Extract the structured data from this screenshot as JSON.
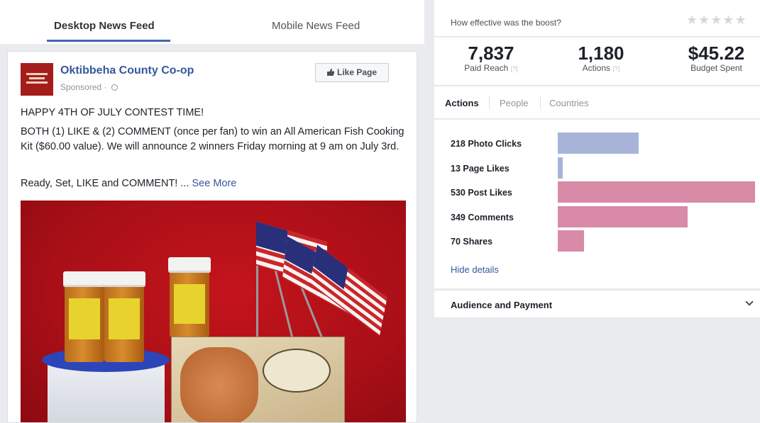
{
  "feed_tabs": {
    "desktop": "Desktop News Feed",
    "mobile": "Mobile News Feed"
  },
  "post": {
    "page_name": "Oktibbeha County Co-op",
    "sponsored": "Sponsored ·",
    "like_page": "Like Page",
    "headline": "HAPPY 4TH OF JULY CONTEST TIME!",
    "body": "BOTH (1) LIKE & (2) COMMENT (once per fan) to win an All American Fish Cooking Kit ($60.00 value). We will announce 2 winners Friday morning at 9 am on July 3rd.",
    "cta": "Ready, Set, LIKE and COMMENT! ...",
    "see_more": "See More"
  },
  "rating": {
    "question": "How effective was the boost?",
    "stars": "★★★★★"
  },
  "metrics": {
    "paid_reach": {
      "value": "7,837",
      "label": "Paid Reach",
      "hint": "[?]"
    },
    "actions": {
      "value": "1,180",
      "label": "Actions",
      "hint": "[?]"
    },
    "budget": {
      "value": "$45.22",
      "label": "Budget Spent"
    }
  },
  "subtabs": [
    "Actions",
    "People",
    "Countries"
  ],
  "action_rows": [
    {
      "label": "218 Photo Clicks",
      "value": 218,
      "color": "#a7b4d8"
    },
    {
      "label": "13 Page Likes",
      "value": 13,
      "color": "#a7b4d8"
    },
    {
      "label": "530 Post Likes",
      "value": 530,
      "color": "#d88aa6"
    },
    {
      "label": "349 Comments",
      "value": 349,
      "color": "#d88aa6"
    },
    {
      "label": "70 Shares",
      "value": 70,
      "color": "#d88aa6"
    }
  ],
  "hide_details": "Hide details",
  "audience_payment": "Audience and Payment",
  "colors": {
    "brand_blue": "#4267b2",
    "link": "#365899"
  }
}
